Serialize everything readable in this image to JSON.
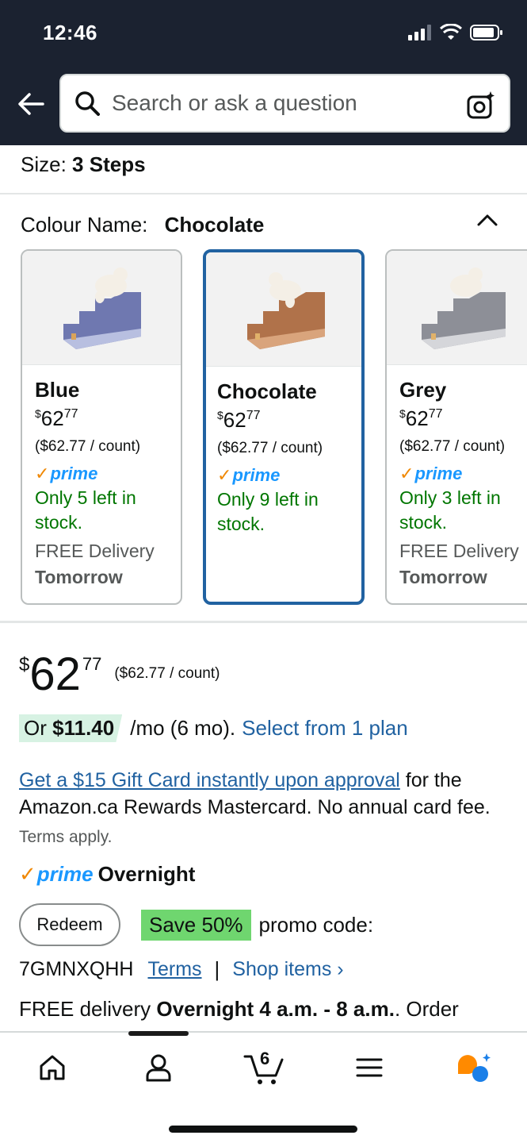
{
  "status_bar": {
    "time": "12:46"
  },
  "header": {
    "search_placeholder": "Search or ask a question"
  },
  "size": {
    "label": "Size:",
    "value": "3 Steps"
  },
  "colour": {
    "label": "Colour Name:",
    "value": "Chocolate"
  },
  "swatches": [
    {
      "name": "Blue",
      "currency": "$",
      "whole": "62",
      "cents": "77",
      "unit_price": "($62.77 / count)",
      "prime": "prime",
      "stock_line1": "Only 5 left in",
      "stock_line2": "stock.",
      "delivery_line1": "FREE Delivery",
      "delivery_line2": "Tomorrow",
      "color": "#6f78b0"
    },
    {
      "name": "Chocolate",
      "currency": "$",
      "whole": "62",
      "cents": "77",
      "unit_price": "($62.77 / count)",
      "prime": "prime",
      "stock_line1": "Only 9 left in",
      "stock_line2": "stock.",
      "color": "#b0724a"
    },
    {
      "name": "Grey",
      "currency": "$",
      "whole": "62",
      "cents": "77",
      "unit_price": "($62.77 / count)",
      "prime": "prime",
      "stock_line1": "Only 3 left in",
      "stock_line2": "stock.",
      "delivery_line1": "FREE Delivery",
      "delivery_line2": "Tomorrow",
      "color": "#8d8f97"
    }
  ],
  "price": {
    "currency": "$",
    "whole": "62",
    "cents": "77",
    "unit": "($62.77 / count)"
  },
  "plan": {
    "or": "Or",
    "amount": "$11.40",
    "term": "/mo (6 mo).",
    "link": "Select from 1 plan"
  },
  "gift": {
    "link": "Get a $15 Gift Card instantly upon approval",
    "text": " for the Amazon.ca Rewards Mastercard. No annual card fee.",
    "small": " Terms apply."
  },
  "prime_overnight": {
    "prime": "prime",
    "label": "Overnight"
  },
  "promo": {
    "redeem": "Redeem",
    "save": "Save 50%",
    "label": "promo code:",
    "code": "7GMNXQHH",
    "terms": "Terms",
    "separator": "|",
    "shop": "Shop items ›"
  },
  "delivery": {
    "prefix": "FREE delivery ",
    "bold": "Overnight 4 a.m. - 8 a.m.",
    "suffix": ". Order"
  },
  "nav": {
    "cart_count": "6"
  },
  "colors": {
    "header_bg": "#1b2230",
    "link": "#2162a1",
    "prime": "#1a98ff",
    "stock": "#007600",
    "selected_border": "#2162a1"
  }
}
